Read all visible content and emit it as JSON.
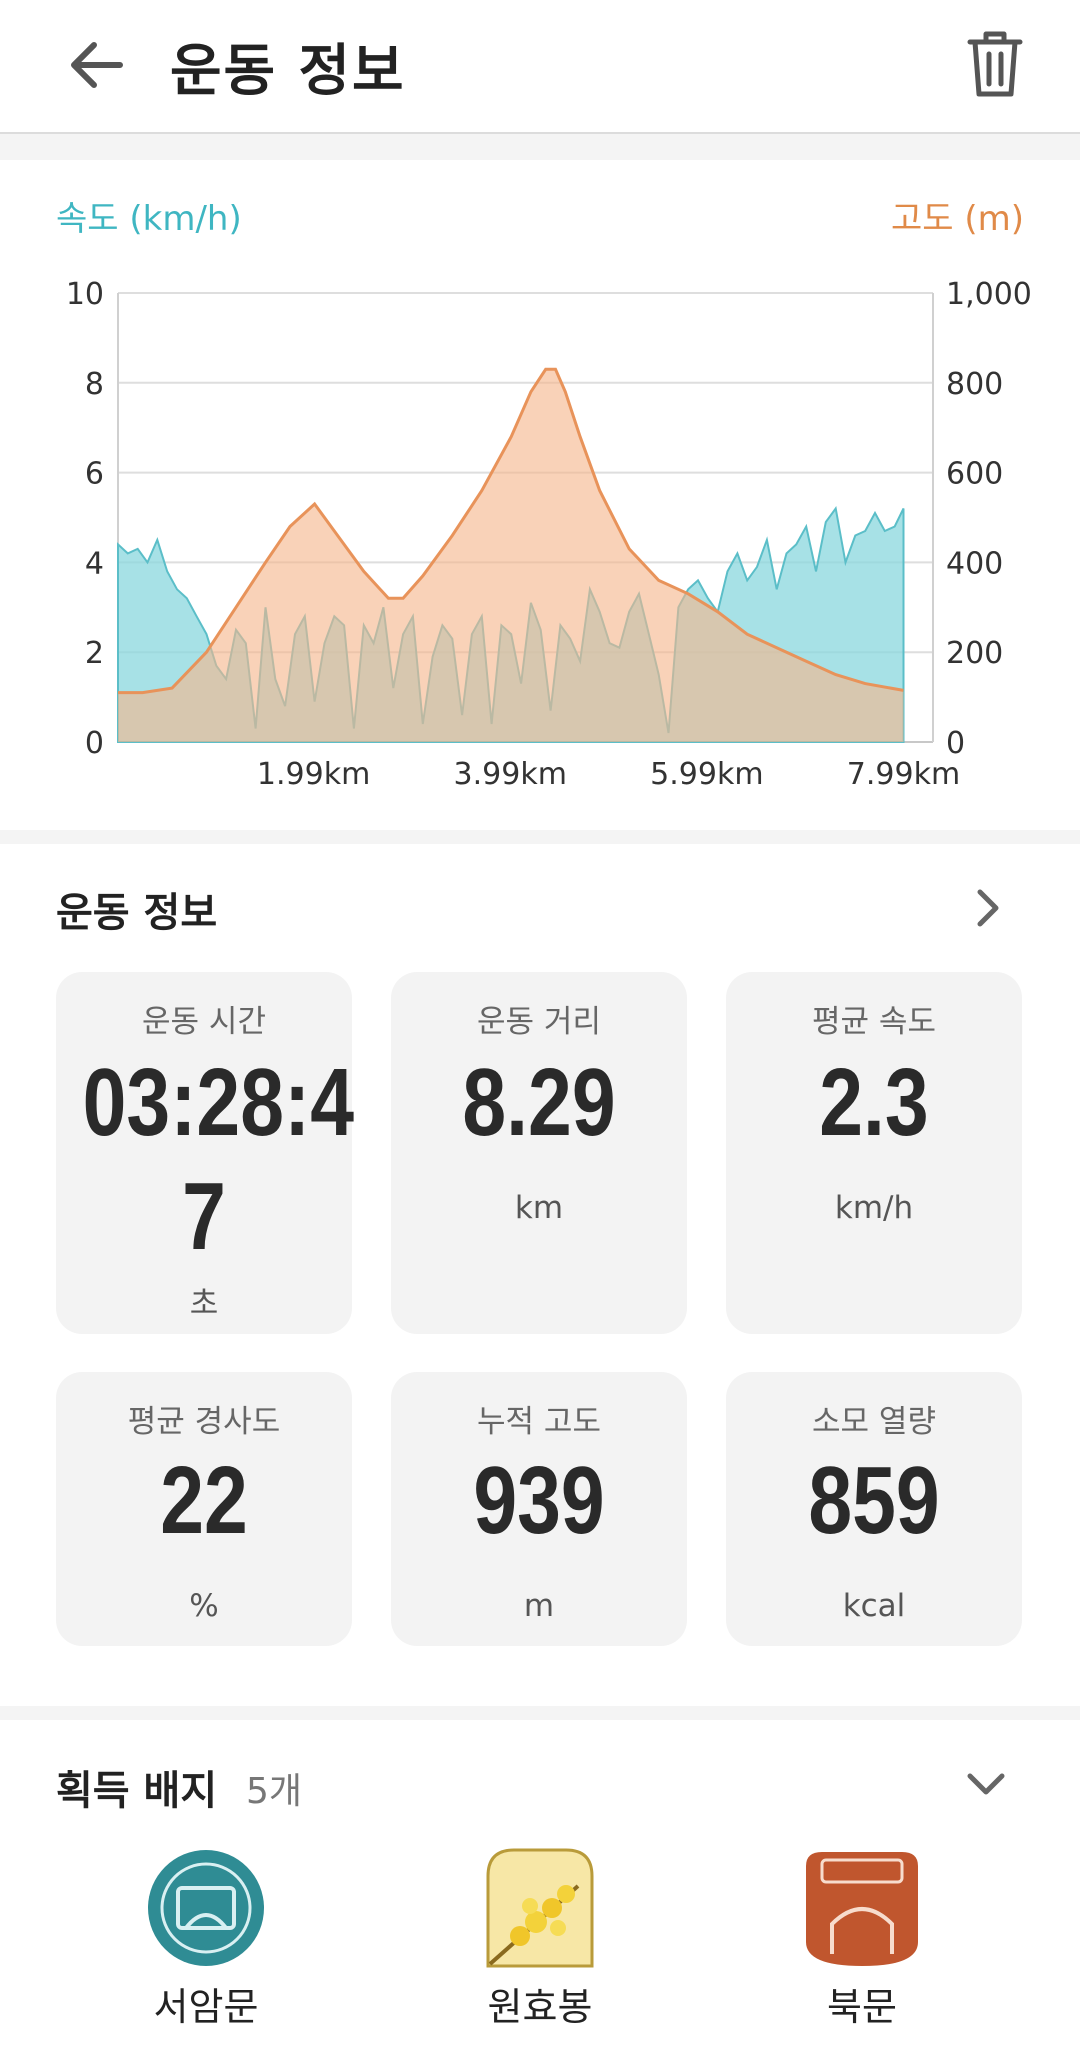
{
  "header": {
    "title": "운동 정보"
  },
  "chart_data": {
    "type": "area",
    "left_axis_label": "속도 (km/h)",
    "right_axis_label": "고도 (m)",
    "left_ticks": [
      "0",
      "2",
      "4",
      "6",
      "8",
      "10"
    ],
    "right_ticks": [
      "0",
      "200",
      "400",
      "600",
      "800",
      "1,000"
    ],
    "x_ticks": [
      "1.99km",
      "3.99km",
      "5.99km",
      "7.99km"
    ],
    "ylim_speed": [
      0,
      10
    ],
    "ylim_altitude": [
      0,
      1000
    ],
    "grid": true,
    "colors": {
      "speed": "#8ad7de",
      "altitude": "#f5b68c",
      "altitude_line": "#e8935a",
      "speed_label": "#3fb6c2",
      "alt_label": "#e08a48"
    },
    "series": [
      {
        "name": "고도 (m)",
        "x": [
          0,
          0.25,
          0.55,
          0.9,
          1.2,
          1.5,
          1.75,
          2.0,
          2.2,
          2.5,
          2.75,
          2.9,
          3.1,
          3.4,
          3.7,
          4.0,
          4.2,
          4.35,
          4.45,
          4.55,
          4.7,
          4.9,
          5.2,
          5.5,
          5.8,
          6.1,
          6.4,
          6.7,
          7.0,
          7.3,
          7.6,
          7.99
        ],
        "values": [
          110,
          110,
          120,
          200,
          300,
          400,
          480,
          530,
          470,
          380,
          320,
          320,
          370,
          460,
          560,
          680,
          780,
          830,
          830,
          780,
          680,
          560,
          430,
          360,
          330,
          290,
          240,
          210,
          180,
          150,
          130,
          115
        ]
      },
      {
        "name": "속도 (km/h)",
        "x": [
          0,
          0.1,
          0.2,
          0.3,
          0.4,
          0.5,
          0.6,
          0.7,
          0.8,
          0.9,
          1.0,
          1.1,
          1.2,
          1.3,
          1.4,
          1.5,
          1.6,
          1.7,
          1.8,
          1.9,
          2.0,
          2.1,
          2.2,
          2.3,
          2.4,
          2.5,
          2.6,
          2.7,
          2.8,
          2.9,
          3.0,
          3.1,
          3.2,
          3.3,
          3.4,
          3.5,
          3.6,
          3.7,
          3.8,
          3.9,
          4.0,
          4.1,
          4.2,
          4.3,
          4.4,
          4.5,
          4.6,
          4.7,
          4.8,
          4.9,
          5.0,
          5.1,
          5.2,
          5.3,
          5.4,
          5.5,
          5.6,
          5.7,
          5.8,
          5.9,
          6.0,
          6.1,
          6.2,
          6.3,
          6.4,
          6.5,
          6.6,
          6.7,
          6.8,
          6.9,
          7.0,
          7.1,
          7.2,
          7.3,
          7.4,
          7.5,
          7.6,
          7.7,
          7.8,
          7.9,
          7.99
        ],
        "values": [
          4.4,
          4.2,
          4.3,
          4.0,
          4.5,
          3.8,
          3.4,
          3.2,
          2.8,
          2.4,
          1.7,
          1.4,
          2.5,
          2.2,
          0.3,
          3.0,
          1.4,
          0.8,
          2.4,
          2.8,
          0.9,
          2.2,
          2.8,
          2.6,
          0.3,
          2.6,
          2.2,
          3.0,
          1.2,
          2.4,
          2.8,
          0.4,
          1.9,
          2.6,
          2.3,
          0.6,
          2.4,
          2.8,
          0.4,
          2.6,
          2.4,
          1.3,
          3.1,
          2.5,
          0.7,
          2.6,
          2.3,
          1.8,
          3.4,
          2.9,
          2.2,
          2.1,
          2.9,
          3.3,
          2.4,
          1.5,
          0.2,
          3.0,
          3.4,
          3.6,
          3.2,
          2.9,
          3.8,
          4.2,
          3.6,
          3.9,
          4.5,
          3.4,
          4.2,
          4.4,
          4.8,
          3.8,
          4.9,
          5.2,
          4.0,
          4.6,
          4.7,
          5.1,
          4.7,
          4.8,
          5.2
        ]
      }
    ]
  },
  "summary": {
    "title": "운동 정보",
    "cards": [
      {
        "label": "운동 시간",
        "value_line1": "03:28:4",
        "value_line2": "7",
        "unit": "초"
      },
      {
        "label": "운동 거리",
        "value": "8.29",
        "unit": "km"
      },
      {
        "label": "평균 속도",
        "value": "2.3",
        "unit": "km/h"
      },
      {
        "label": "평균 경사도",
        "value": "22",
        "unit": "%"
      },
      {
        "label": "누적 고도",
        "value": "939",
        "unit": "m"
      },
      {
        "label": "소모 열량",
        "value": "859",
        "unit": "kcal"
      }
    ]
  },
  "badges": {
    "title": "획득 배지",
    "count": "5개",
    "items": [
      {
        "name": "서암문",
        "color": "#2f8c94"
      },
      {
        "name": "원효봉",
        "color": "#e9c83f"
      },
      {
        "name": "북문",
        "color": "#c0562e"
      }
    ]
  }
}
